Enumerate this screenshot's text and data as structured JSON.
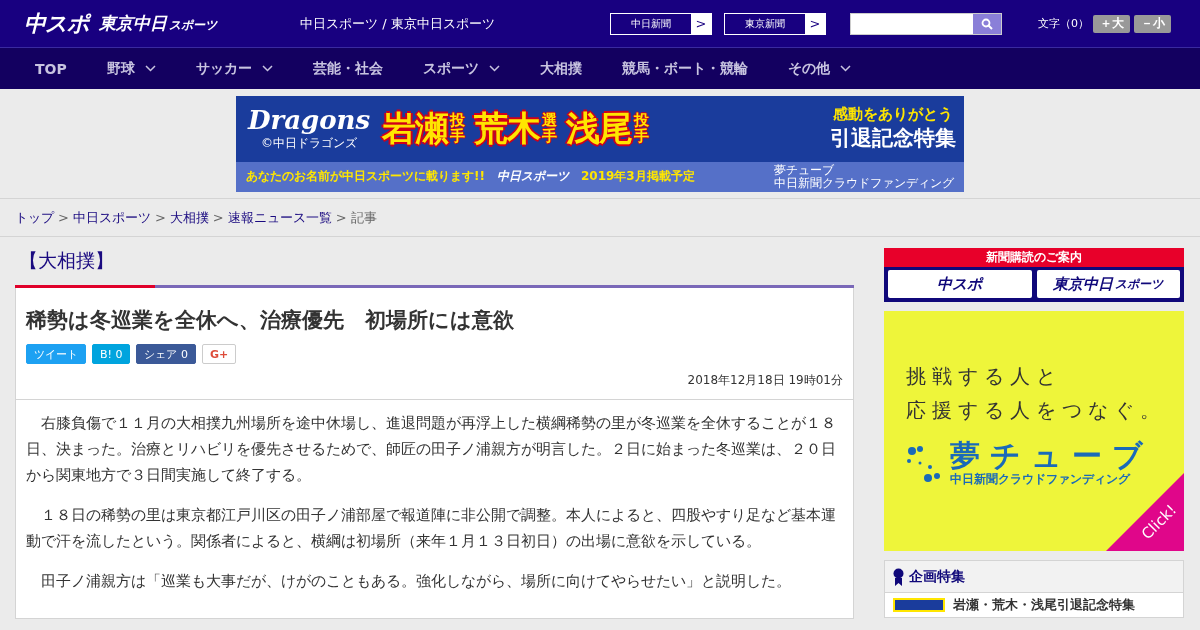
{
  "header": {
    "logo_main": "中スポ",
    "logo_sub": "東京中日",
    "logo_sub_small": "スポーツ",
    "site_title": "中日スポーツ / 東京中日スポーツ",
    "link_buttons": [
      {
        "label": "中日新聞",
        "arrow": ">"
      },
      {
        "label": "東京新聞",
        "arrow": ">"
      }
    ],
    "font_size": {
      "label": "文字（0）",
      "buttons": [
        "＋大",
        "－小"
      ]
    }
  },
  "nav": [
    {
      "label": "TOP",
      "dropdown": false
    },
    {
      "label": "野球",
      "dropdown": true
    },
    {
      "label": "サッカー",
      "dropdown": true
    },
    {
      "label": "芸能・社会",
      "dropdown": false
    },
    {
      "label": "スポーツ",
      "dropdown": true
    },
    {
      "label": "大相撲",
      "dropdown": false
    },
    {
      "label": "競馬・ボート・競輪",
      "dropdown": false
    },
    {
      "label": "その他",
      "dropdown": true
    }
  ],
  "banner": {
    "team": "Dragons",
    "copyright": "©中日ドラゴンズ",
    "players": [
      {
        "name": "岩瀬",
        "role": "投手"
      },
      {
        "name": "荒木",
        "role": "選手"
      },
      {
        "name": "浅尾",
        "role": "投手"
      }
    ],
    "thanks": "感動をありがとう",
    "feature": "引退記念特集",
    "strip": "あなたのお名前が中日スポーツに載ります!!",
    "strip_logo": "中日スポーツ",
    "strip_date": "2019年3月掲載予定",
    "strip_brand": "夢チューブ",
    "strip_brand_sub": "中日新聞クラウドファンディング"
  },
  "breadcrumb": [
    {
      "label": "トップ",
      "link": true
    },
    {
      "label": "中日スポーツ",
      "link": true
    },
    {
      "label": "大相撲",
      "link": true
    },
    {
      "label": "速報ニュース一覧",
      "link": true
    },
    {
      "label": "記事",
      "link": false
    }
  ],
  "category": "【大相撲】",
  "article": {
    "title": "稀勢は冬巡業を全休へ、治療優先　初場所には意欲",
    "share": [
      {
        "kind": "twitter",
        "label": "ツイート"
      },
      {
        "kind": "hatena",
        "label": "B!",
        "count": "0"
      },
      {
        "kind": "facebook",
        "label": "シェア",
        "count": "0"
      },
      {
        "kind": "gplus",
        "label": "G+"
      }
    ],
    "date": "2018年12月18日 19時01分",
    "paragraphs": [
      "右膝負傷で１１月の大相撲九州場所を途中休場し、進退問題が再浮上した横綱稀勢の里が冬巡業を全休することが１８日、決まった。治療とリハビリを優先させるためで、師匠の田子ノ浦親方が明言した。２日に始まった冬巡業は、２０日から関東地方で３日間実施して終了する。",
      "１８日の稀勢の里は東京都江戸川区の田子ノ浦部屋で報道陣に非公開で調整。本人によると、四股やすり足など基本運動で汗を流したという。関係者によると、横綱は初場所（来年１月１３日初日）の出場に意欲を示している。",
      "田子ノ浦親方は「巡業も大事だが、けがのこともある。強化しながら、場所に向けてやらせたい」と説明した。"
    ]
  },
  "sidebar": {
    "subscribe": {
      "title": "新聞購読のご案内",
      "buttons": [
        {
          "label": "中スポ"
        },
        {
          "label": "東京中日",
          "small": "スポーツ"
        }
      ]
    },
    "ad": {
      "lines": [
        "挑戦する人と",
        "応援する人をつなぐ。"
      ],
      "brand": "夢チューブ",
      "brand_sub": "中日新聞クラウドファンディング",
      "corner": "Click!"
    },
    "features": {
      "title": "企画特集",
      "items": [
        {
          "label": "岩瀬・荒木・浅尾引退記念特集"
        }
      ]
    }
  }
}
